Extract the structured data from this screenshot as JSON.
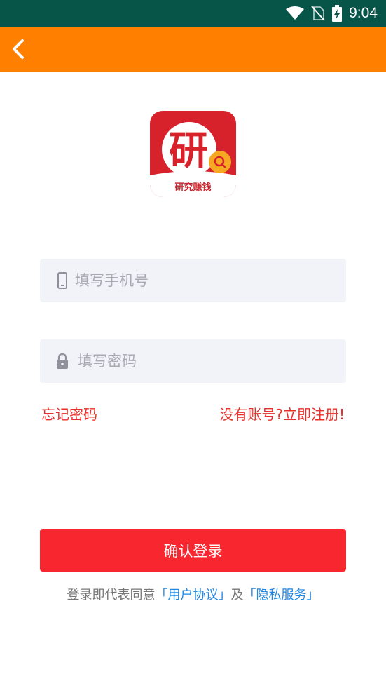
{
  "status_bar": {
    "time": "9:04",
    "icons": [
      "wifi-icon",
      "no-sim-icon",
      "battery-charging-icon"
    ]
  },
  "header": {
    "back_icon": "chevron-left-icon"
  },
  "logo": {
    "glyph": "研",
    "caption": "研究赚钱",
    "colors": {
      "red": "#D8222B",
      "white": "#ffffff",
      "accent": "#F7A823"
    }
  },
  "form": {
    "phone": {
      "icon": "phone-icon",
      "placeholder": "填写手机号",
      "value": ""
    },
    "password": {
      "icon": "lock-icon",
      "placeholder": "填写密码",
      "value": ""
    },
    "forgot_label": "忘记密码",
    "register_label": "没有账号?立即注册!",
    "submit_label": "确认登录"
  },
  "agreement": {
    "prefix": "登录即代表同意",
    "user_agreement": "「用户协议」",
    "conjunction": "及",
    "privacy": "「隐私服务」"
  },
  "colors": {
    "status_bar": "#075449",
    "header": "#FF7F00",
    "primary_button": "#F8262E",
    "link_red": "#E8302A",
    "link_blue": "#1E88E5",
    "field_bg": "#F1F3F8"
  }
}
